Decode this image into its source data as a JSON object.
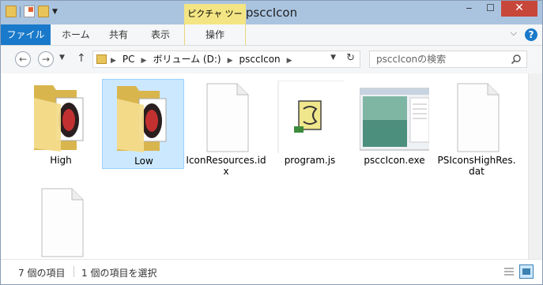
{
  "window": {
    "title": "psccIcon"
  },
  "ribbon": {
    "file_tab": "ファイル",
    "home_tab": "ホーム",
    "share_tab": "共有",
    "view_tab": "表示",
    "context_header": "ピクチャ ツール",
    "context_tab": "操作",
    "help": "?"
  },
  "nav": {
    "crumbs": [
      "PC",
      "ボリューム (D:)",
      "psccIcon"
    ],
    "search_placeholder": "psccIconの検索"
  },
  "items": [
    {
      "label": "High",
      "type": "folder"
    },
    {
      "label": "Low",
      "type": "folder",
      "selected": true
    },
    {
      "label": "IconResources.idx",
      "type": "blank"
    },
    {
      "label": "program.js",
      "type": "script"
    },
    {
      "label": "psccIcon.exe",
      "type": "exe"
    },
    {
      "label": "PSIconsHighRes.dat",
      "type": "blank"
    },
    {
      "label": "",
      "type": "blank"
    }
  ],
  "status": {
    "count": "7 個の項目",
    "selected": "1 個の項目を選択"
  }
}
